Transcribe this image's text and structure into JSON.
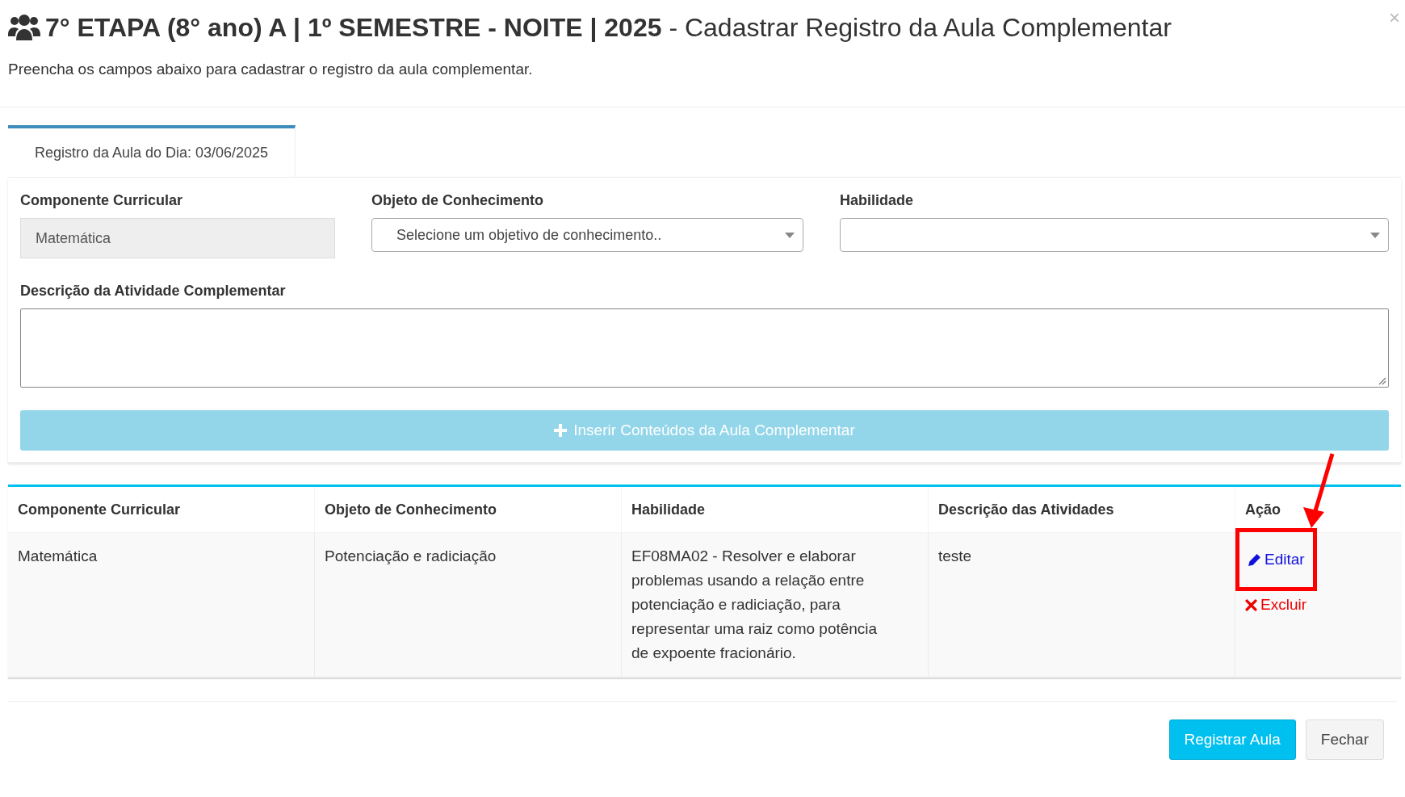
{
  "dialog": {
    "title": "**7° ETAPA (8° ano) A | 1º SEMESTRE - NOITE | 2025** - Cadastrar Registro da Aula Complementar",
    "close": "×",
    "subtitle": "Preencha os campos abaixo para cadastrar o registro da aula complementar."
  },
  "tabs": [
    {
      "label": "Registro da Aula do Dia: 03/06/2025",
      "selected": true
    }
  ],
  "form": {
    "fields": [
      {
        "kind": "readonly",
        "label": "Componente Curricular",
        "value": "Matemática"
      },
      {
        "kind": "select",
        "label": "Objeto de Conhecimento",
        "placeholder": "Selecione um objetivo de conhecimento.."
      },
      {
        "kind": "select",
        "label": "Habilidade"
      }
    ],
    "description": {
      "label": "Descrição da Atividade Complementar"
    },
    "add_button": {
      "label": "Inserir Conteúdos da Aula Complementar",
      "disabled": true
    }
  },
  "table": {
    "columns": [
      "Componente Curricular",
      "Objeto de Conhecimento",
      "Habilidade",
      "Descrição das Atividades",
      "Ação"
    ],
    "rows": [
      {
        "cells": [
          "Matemática",
          "Potenciação e radiciação",
          "EF08MA02 - Resolver e elaborar problemas usando a relação entre potenciação e radiciação, para representar uma raiz como potência de expoente fracionário.",
          "teste"
        ],
        "actions": [
          {
            "kind": "edit",
            "label": "Editar",
            "highlighted": true
          },
          {
            "kind": "delete",
            "label": "Excluir",
            "highlighted": false
          }
        ]
      }
    ]
  },
  "footer_buttons": [
    {
      "kind": "primary",
      "label": "Registrar Aula"
    },
    {
      "kind": "default",
      "label": "Fechar"
    }
  ]
}
